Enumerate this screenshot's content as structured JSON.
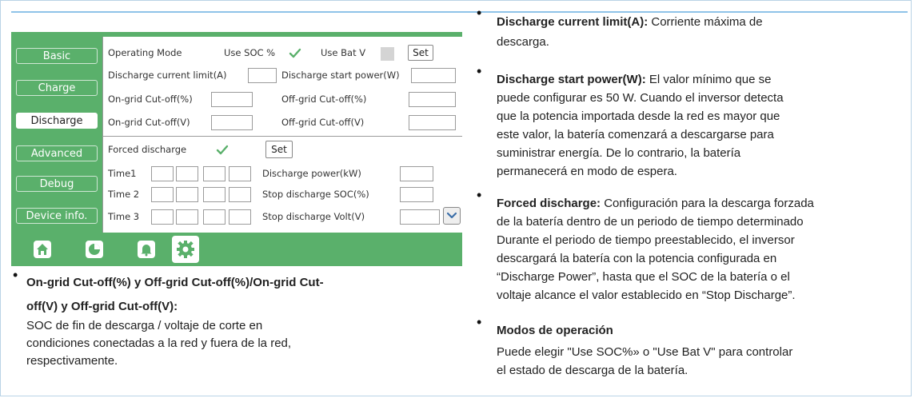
{
  "screen": {
    "sidebar": {
      "items": [
        {
          "label": "Basic"
        },
        {
          "label": "Charge"
        },
        {
          "label": "Discharge"
        },
        {
          "label": "Advanced"
        },
        {
          "label": "Debug"
        },
        {
          "label": "Device info."
        }
      ],
      "active": "Discharge"
    },
    "operating_mode": {
      "label": "Operating Mode",
      "use_soc_label": "Use SOC %",
      "use_soc_checked": true,
      "use_bat_v_label": "Use Bat V",
      "use_bat_v_checked": false,
      "set_label": "Set"
    },
    "fields": {
      "discharge_current_limit": "Discharge current limit(A)",
      "discharge_start_power": "Discharge start power(W)",
      "on_grid_cutoff_pct": "On-grid Cut-off(%)",
      "off_grid_cutoff_pct": "Off-grid Cut-off(%)",
      "on_grid_cutoff_v": "On-grid Cut-off(V)",
      "off_grid_cutoff_v": "Off-grid Cut-off(V)"
    },
    "forced": {
      "label": "Forced discharge",
      "checked": true,
      "set_label": "Set",
      "time1": "Time1",
      "time2": "Time 2",
      "time3": "Time 3",
      "discharge_power": "Discharge power(kW)",
      "stop_soc": "Stop discharge SOC(%)",
      "stop_volt": "Stop discharge Volt(V)"
    },
    "footer_icons": [
      "home-icon",
      "pie-chart-icon",
      "bell-icon",
      "gear-icon"
    ],
    "accent": "#5ab06b"
  },
  "left_bullet": {
    "title_line1": "On-grid Cut-off(%) y Off-grid Cut-off(%)/On-grid Cut-",
    "title_line2": "off(V) y Off-grid Cut-off(V):",
    "body_line1": "SOC de fin de descarga / voltaje de corte en",
    "body_line2": "condiciones conectadas a la red y fuera de la red,",
    "body_line3": "respectivamente."
  },
  "right_bullets": [
    {
      "title": "Discharge current limit(A):",
      "lines": [
        " Corriente máxima de",
        "descarga."
      ]
    },
    {
      "title": "Discharge start power(W):",
      "lines": [
        " El valor mínimo que se",
        "puede configurar es 50 W. Cuando el inversor detecta",
        "que la potencia importada desde la red es mayor que",
        "este valor, la batería comenzará a descargarse para",
        "suministrar energía. De lo contrario, la batería",
        "permanecerá en modo de espera."
      ]
    },
    {
      "title": "Forced discharge:",
      "lines": [
        " Configuración para la descarga forzada",
        "de la batería dentro de un periodo de tiempo determinado",
        "Durante el periodo de tiempo preestablecido, el inversor",
        "descargará la batería con la potencia configurada en",
        "“Discharge Power”, hasta que el SOC de la batería o el",
        "voltaje alcance el valor establecido en “Stop Discharge”."
      ]
    },
    {
      "title": "Modos de operación",
      "lines": [
        "",
        "Puede elegir \"Use SOC%» o \"Use Bat V\" para controlar",
        "el estado de descarga de la batería."
      ]
    }
  ]
}
